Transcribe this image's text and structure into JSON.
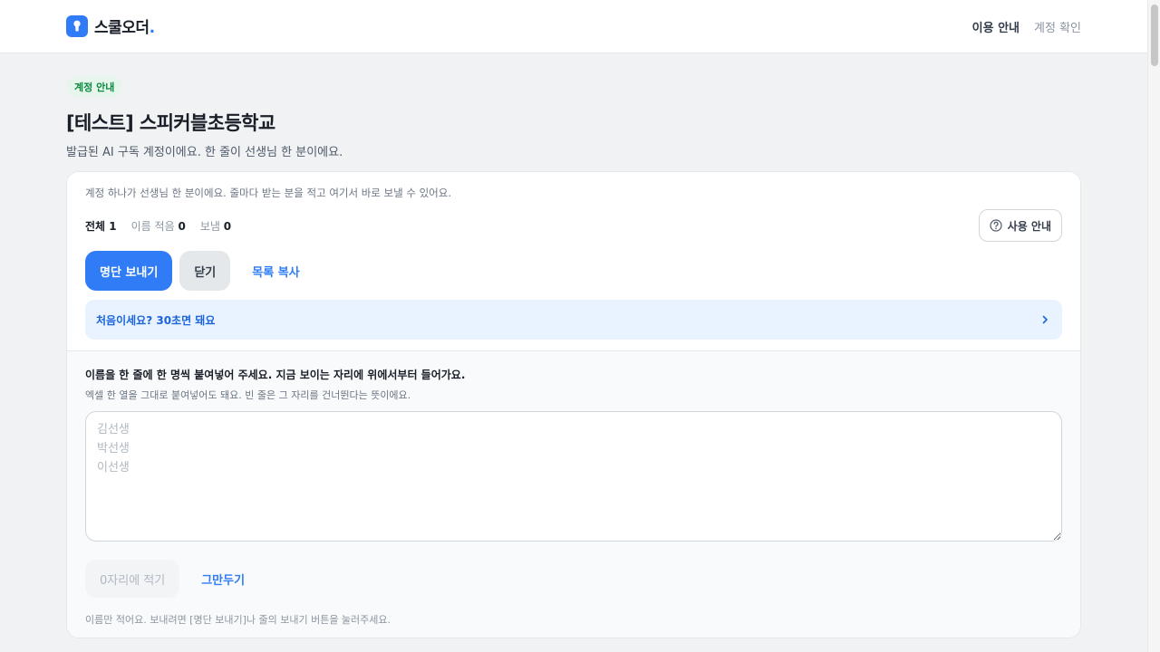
{
  "header": {
    "brand_name": "스쿨오더",
    "brand_dot": ".",
    "nav": [
      {
        "label": "이용 안내",
        "active": true
      },
      {
        "label": "계정 확인",
        "active": false
      }
    ]
  },
  "page": {
    "badge": "계정 안내",
    "title": "[테스트] 스피커블초등학교",
    "subtitle": "발급된 AI 구독 계정이에요. 한 줄이 선생님 한 분이에요."
  },
  "card": {
    "description": "계정 하나가 선생님 한 분이에요. 줄마다 받는 분을 적고 여기서 바로 보낼 수 있어요.",
    "stats": {
      "total_label": "전체",
      "total_value": "1",
      "named_label": "이름 적음",
      "named_value": "0",
      "sent_label": "보냄",
      "sent_value": "0"
    },
    "help_button": "사용 안내",
    "buttons": {
      "send_list": "명단 보내기",
      "close": "닫기",
      "copy_list": "목록 복사"
    },
    "tip": "처음이세요? 30초면 돼요",
    "paste": {
      "title": "이름을 한 줄에 한 명씩 붙여넣어 주세요. 지금 보이는 자리에 위에서부터 들어가요.",
      "subtitle": "엑셀 한 열을 그대로 붙여넣어도 돼요. 빈 줄은 그 자리를 건너뛴다는 뜻이에요.",
      "placeholder": "김선생\n박선생\n이선생",
      "value": "",
      "fill_button": "0자리에 적기",
      "cancel_button": "그만두기",
      "footnote": "이름만 적어요. 보내려면 [명단 보내기]나 줄의 보내기 버튼을 눌러주세요."
    }
  },
  "colors": {
    "primary": "#2f7cf6",
    "badge_bg": "#e6f6ec",
    "badge_text": "#0b8a3e",
    "tip_bg": "#e8f3ff"
  }
}
